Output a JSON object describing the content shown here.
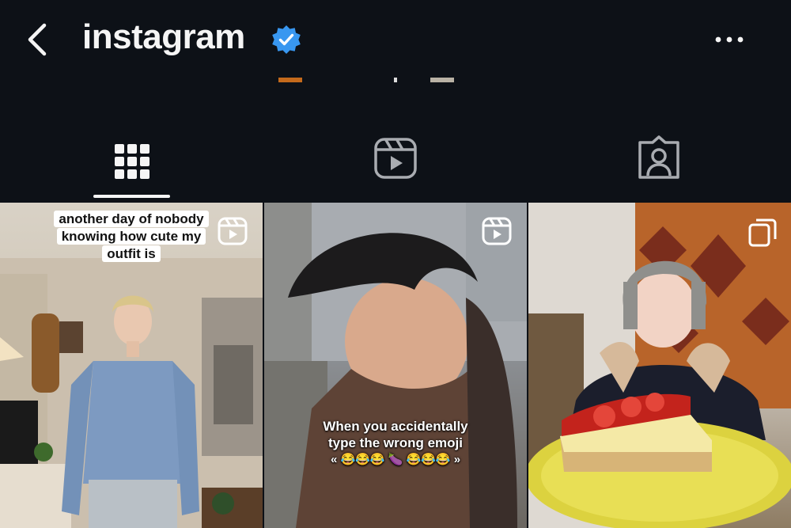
{
  "header": {
    "back_label": "Back",
    "title": "instagram",
    "verified_icon": "verified-badge-icon",
    "more_icon": "more-options-icon"
  },
  "tabs": [
    {
      "name": "posts",
      "icon": "grid-icon",
      "active": true
    },
    {
      "name": "reels",
      "icon": "reels-icon",
      "active": false
    },
    {
      "name": "tagged",
      "icon": "tagged-user-icon",
      "active": false
    }
  ],
  "colors": {
    "background": "#0d1117",
    "text": "#f5f5f5",
    "verified": "#3897f0"
  },
  "posts": [
    {
      "type": "reel",
      "caption": "another day of nobody knowing how cute my outfit is",
      "badge_icon": "reel-badge-icon"
    },
    {
      "type": "reel",
      "caption_line1": "When you accidentally",
      "caption_line2": "type the wrong emoji",
      "caption_line3": "« 😂😂😂 🍆 😂😂😂 »",
      "badge_icon": "reel-badge-icon"
    },
    {
      "type": "carousel",
      "badge_icon": "carousel-badge-icon"
    }
  ]
}
